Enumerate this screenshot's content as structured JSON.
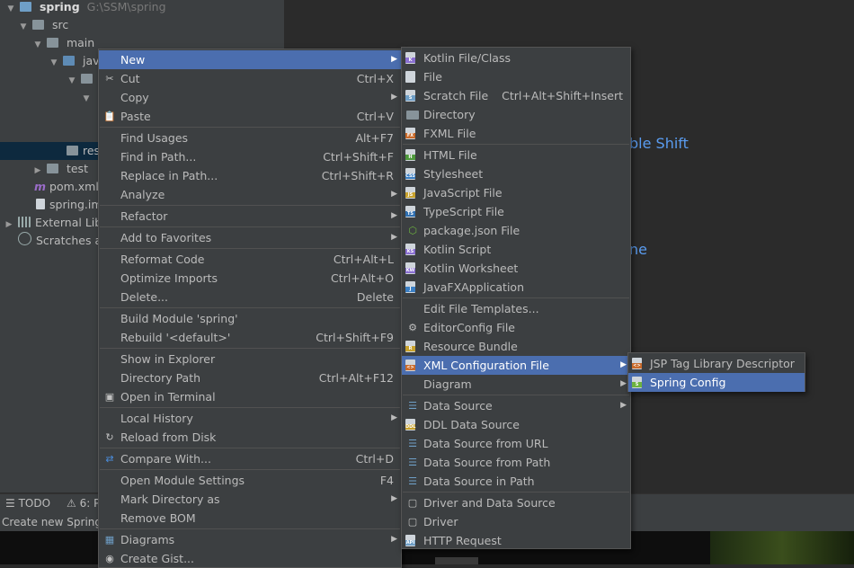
{
  "project_tree": [
    {
      "label": "spring",
      "path": "G:\\SSM\\spring",
      "indent": 0
    },
    {
      "label": "src",
      "indent": 1
    },
    {
      "label": "main",
      "indent": 2
    },
    {
      "label": "jav",
      "indent": 3
    },
    {
      "label": "res",
      "indent": 4
    },
    {
      "label": "test",
      "indent": 2
    },
    {
      "label": "pom.xml",
      "indent": 1
    },
    {
      "label": "spring.im",
      "indent": 1
    },
    {
      "label": "External Libr",
      "indent": 0
    },
    {
      "label": "Scratches ar",
      "indent": 0
    }
  ],
  "editor_hints": [
    "ble Shift",
    "ne"
  ],
  "tool_tabs": {
    "todo": "TODO",
    "six": "6: P"
  },
  "status_text": "Create new Spring",
  "context_menu": [
    {
      "label": "New",
      "sub": true,
      "hl": true
    },
    {
      "label": "Cut",
      "shortcut": "Ctrl+X",
      "icon": "scissors-icon"
    },
    {
      "label": "Copy",
      "sub": true
    },
    {
      "label": "Paste",
      "shortcut": "Ctrl+V",
      "icon": "clipboard-icon"
    },
    {
      "sep": true
    },
    {
      "label": "Find Usages",
      "shortcut": "Alt+F7"
    },
    {
      "label": "Find in Path...",
      "shortcut": "Ctrl+Shift+F"
    },
    {
      "label": "Replace in Path...",
      "shortcut": "Ctrl+Shift+R"
    },
    {
      "label": "Analyze",
      "sub": true
    },
    {
      "sep": true
    },
    {
      "label": "Refactor",
      "sub": true
    },
    {
      "sep": true
    },
    {
      "label": "Add to Favorites",
      "sub": true
    },
    {
      "sep": true
    },
    {
      "label": "Reformat Code",
      "shortcut": "Ctrl+Alt+L"
    },
    {
      "label": "Optimize Imports",
      "shortcut": "Ctrl+Alt+O"
    },
    {
      "label": "Delete...",
      "shortcut": "Delete"
    },
    {
      "sep": true
    },
    {
      "label": "Build Module 'spring'"
    },
    {
      "label": "Rebuild '<default>'",
      "shortcut": "Ctrl+Shift+F9"
    },
    {
      "sep": true
    },
    {
      "label": "Show in Explorer"
    },
    {
      "label": "Directory Path",
      "shortcut": "Ctrl+Alt+F12"
    },
    {
      "label": "Open in Terminal",
      "icon": "terminal-icon"
    },
    {
      "sep": true
    },
    {
      "label": "Local History",
      "sub": true
    },
    {
      "label": "Reload from Disk",
      "icon": "reload-icon"
    },
    {
      "sep": true
    },
    {
      "label": "Compare With...",
      "shortcut": "Ctrl+D",
      "icon": "compare-icon"
    },
    {
      "sep": true
    },
    {
      "label": "Open Module Settings",
      "shortcut": "F4"
    },
    {
      "label": "Mark Directory as",
      "sub": true
    },
    {
      "label": "Remove BOM"
    },
    {
      "sep": true
    },
    {
      "label": "Diagrams",
      "sub": true,
      "icon": "diagram-icon"
    },
    {
      "label": "Create Gist...",
      "icon": "github-icon"
    }
  ],
  "new_menu": [
    {
      "label": "Kotlin File/Class",
      "icon": "kotlin-file-icon"
    },
    {
      "label": "File",
      "icon": "file-icon"
    },
    {
      "label": "Scratch File",
      "shortcut": "Ctrl+Alt+Shift+Insert",
      "icon": "scratch-file-icon"
    },
    {
      "label": "Directory",
      "icon": "folder-icon"
    },
    {
      "label": "FXML File",
      "icon": "fxml-file-icon"
    },
    {
      "sep": true
    },
    {
      "label": "HTML File",
      "icon": "html-file-icon"
    },
    {
      "label": "Stylesheet",
      "icon": "css-file-icon"
    },
    {
      "label": "JavaScript File",
      "icon": "js-file-icon"
    },
    {
      "label": "TypeScript File",
      "icon": "ts-file-icon"
    },
    {
      "label": "package.json File",
      "icon": "nodejs-icon"
    },
    {
      "label": "Kotlin Script",
      "icon": "kotlin-script-icon"
    },
    {
      "label": "Kotlin Worksheet",
      "icon": "kotlin-worksheet-icon"
    },
    {
      "label": "JavaFXApplication",
      "icon": "javafx-icon"
    },
    {
      "sep": true
    },
    {
      "label": "Edit File Templates..."
    },
    {
      "label": "EditorConfig File",
      "icon": "gear-icon"
    },
    {
      "label": "Resource Bundle",
      "icon": "resource-bundle-icon"
    },
    {
      "label": "XML Configuration File",
      "sub": true,
      "hl": true,
      "icon": "xml-file-icon"
    },
    {
      "label": "Diagram",
      "sub": true
    },
    {
      "sep": true
    },
    {
      "label": "Data Source",
      "sub": true,
      "icon": "database-icon"
    },
    {
      "label": "DDL Data Source",
      "icon": "ddl-icon"
    },
    {
      "label": "Data Source from URL",
      "icon": "database-url-icon"
    },
    {
      "label": "Data Source from Path",
      "icon": "database-path-icon"
    },
    {
      "label": "Data Source in Path",
      "icon": "database-icon"
    },
    {
      "sep": true
    },
    {
      "label": "Driver and Data Source",
      "icon": "driver-datasource-icon"
    },
    {
      "label": "Driver",
      "icon": "driver-icon"
    },
    {
      "label": "HTTP Request",
      "icon": "api-icon"
    }
  ],
  "xml_menu": [
    {
      "label": "JSP Tag Library Descriptor",
      "icon": "xml-file-icon"
    },
    {
      "label": "Spring Config",
      "hl": true,
      "icon": "spring-config-icon"
    }
  ],
  "colors": {
    "highlight": "#4b6eaf",
    "menu_bg": "#3c3f41",
    "hint": "#5a9cf0"
  }
}
